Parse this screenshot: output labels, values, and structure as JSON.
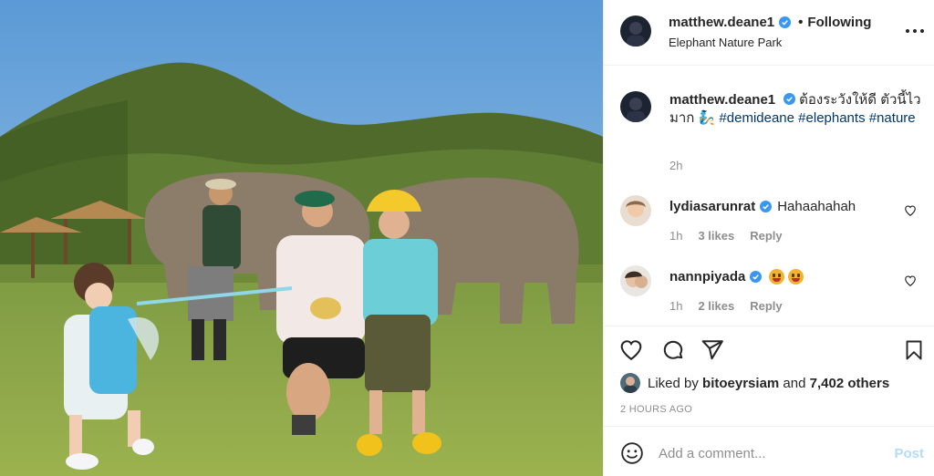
{
  "header": {
    "username": "matthew.deane1",
    "separator": "•",
    "follow_state": "Following",
    "location": "Elephant Nature Park",
    "more_icon": "more-options-icon"
  },
  "caption": {
    "username": "matthew.deane1",
    "text": "ต้องระวังให้ดี ตัวนี้ไวมาก 🧞",
    "hashtags": [
      "#demideane",
      "#elephants",
      "#nature"
    ],
    "time": "2h"
  },
  "comments": [
    {
      "username": "lydiasarunrat",
      "text": "Hahaahahah",
      "time": "1h",
      "likes": "3 likes",
      "reply": "Reply",
      "verified": true
    },
    {
      "username": "nannpiyada",
      "text": "",
      "emoji_count": 2,
      "time": "1h",
      "likes": "2 likes",
      "reply": "Reply",
      "verified": true
    }
  ],
  "actions": {
    "icons": [
      "heart-icon",
      "comment-icon",
      "share-icon",
      "bookmark-icon"
    ],
    "liked_by_prefix": "Liked by ",
    "liked_by_user": "bitoeyrsiam",
    "liked_by_and": " and ",
    "liked_by_others": "7,402 others",
    "time_ago": "2 HOURS AGO"
  },
  "add_comment": {
    "placeholder": "Add a comment...",
    "post_label": "Post"
  },
  "colors": {
    "verified": "#3897f0",
    "hashtag": "#00376b",
    "post_disabled": "#b3dbff",
    "muted": "#8e8e8e"
  }
}
